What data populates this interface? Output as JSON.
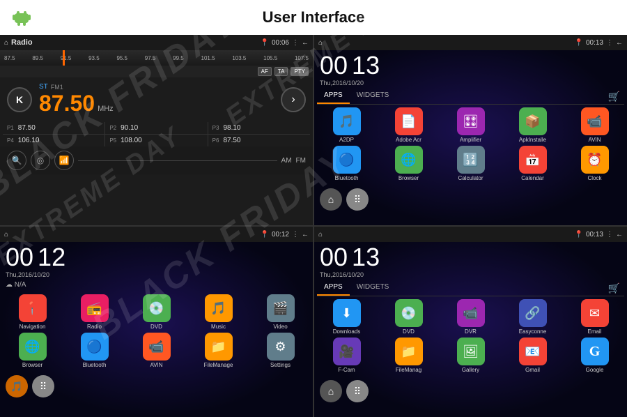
{
  "header": {
    "title": "User Interface"
  },
  "q1": {
    "bar": {
      "home": "⌂",
      "title": "Radio",
      "location": "📍",
      "time": "00:06",
      "more": "⋮",
      "back": "←"
    },
    "freqs": [
      "87.5",
      "89.5",
      "91.5",
      "93.5",
      "95.5",
      "97.5",
      "99.5",
      "101.5",
      "103.5",
      "105.5",
      "107.5"
    ],
    "buttons": [
      "AF",
      "TA",
      "PTY"
    ],
    "st": "ST",
    "fm": "FM1",
    "frequency": "87.50",
    "mhz": "MHz",
    "presets": [
      {
        "label": "P1",
        "freq": "87.50"
      },
      {
        "label": "P2",
        "freq": "90.10"
      },
      {
        "label": "P3",
        "freq": "98.10"
      },
      {
        "label": "P4",
        "freq": "106.10"
      },
      {
        "label": "P5",
        "freq": "108.00"
      },
      {
        "label": "P6",
        "freq": "87.50"
      }
    ],
    "modes": [
      "AM",
      "FM"
    ]
  },
  "q2": {
    "bar": {
      "home": "⌂",
      "location": "📍",
      "time": "00:13",
      "more": "⋮",
      "back": "←"
    },
    "clock": {
      "hour": "00",
      "min": "13"
    },
    "date": "Thu,2016/10/20",
    "tabs": [
      "APPS",
      "WIDGETS"
    ],
    "activeTab": "APPS",
    "apps": [
      {
        "label": "A2DP",
        "icon": "🎵",
        "color": "ic-a2dp"
      },
      {
        "label": "Adobe Acr",
        "icon": "📄",
        "color": "ic-acr"
      },
      {
        "label": "Amplifier",
        "icon": "🎛",
        "color": "ic-amp"
      },
      {
        "label": "ApkInstalle",
        "icon": "📦",
        "color": "ic-apk"
      },
      {
        "label": "AVIN",
        "icon": "📹",
        "color": "ic-avin"
      },
      {
        "label": "Bluetooth",
        "icon": "🔵",
        "color": "ic-bt"
      },
      {
        "label": "Browser",
        "icon": "🌐",
        "color": "ic-browser"
      },
      {
        "label": "Calculator",
        "icon": "🔢",
        "color": "ic-calc"
      },
      {
        "label": "Calendar",
        "icon": "📅",
        "color": "ic-calendar"
      },
      {
        "label": "Clock",
        "icon": "⏰",
        "color": "ic-clock"
      }
    ]
  },
  "q3": {
    "bar": {
      "home": "⌂",
      "location": "📍",
      "time": "00:12",
      "more": "⋮",
      "back": "←"
    },
    "clock": {
      "hour": "00",
      "min": "12"
    },
    "date": "Thu,2016/10/20",
    "apps": [
      {
        "label": "Navigation",
        "icon": "📍",
        "color": "ic-nav"
      },
      {
        "label": "Radio",
        "icon": "📻",
        "color": "ic-radio"
      },
      {
        "label": "DVD",
        "icon": "💿",
        "color": "ic-dvd"
      },
      {
        "label": "Music",
        "icon": "🎵",
        "color": "ic-music"
      },
      {
        "label": "Video",
        "icon": "🎬",
        "color": "ic-video"
      },
      {
        "label": "Browser",
        "icon": "🌐",
        "color": "ic-browser"
      },
      {
        "label": "Bluetooth",
        "icon": "🔵",
        "color": "ic-bt2"
      },
      {
        "label": "AVIN",
        "icon": "📹",
        "color": "ic-avin2"
      },
      {
        "label": "FileManage",
        "icon": "📁",
        "color": "ic-filemgr"
      },
      {
        "label": "Settings",
        "icon": "⚙",
        "color": "ic-settings"
      }
    ]
  },
  "q4": {
    "bar": {
      "home": "⌂",
      "location": "📍",
      "time": "00:13",
      "more": "⋮",
      "back": "←"
    },
    "clock": {
      "hour": "00",
      "min": "13"
    },
    "date": "Thu,2016/10/20",
    "tabs": [
      "APPS",
      "WIDGETS"
    ],
    "activeTab": "APPS",
    "apps": [
      {
        "label": "Downloads",
        "icon": "⬇",
        "color": "ic-dl"
      },
      {
        "label": "DVD",
        "icon": "💿",
        "color": "ic-dvd2"
      },
      {
        "label": "DVR",
        "icon": "📹",
        "color": "ic-dvr"
      },
      {
        "label": "Easyconne",
        "icon": "🔗",
        "color": "ic-easy"
      },
      {
        "label": "Email",
        "icon": "✉",
        "color": "ic-email"
      },
      {
        "label": "F-Cam",
        "icon": "🎥",
        "color": "ic-fcam"
      },
      {
        "label": "FileManag",
        "icon": "📁",
        "color": "ic-filemgr2"
      },
      {
        "label": "Gallery",
        "icon": "🖼",
        "color": "ic-gallery"
      },
      {
        "label": "Gmail",
        "icon": "📧",
        "color": "ic-gmail"
      },
      {
        "label": "Google",
        "icon": "G",
        "color": "ic-google"
      }
    ]
  },
  "watermark": "BLACK FRIDAY"
}
